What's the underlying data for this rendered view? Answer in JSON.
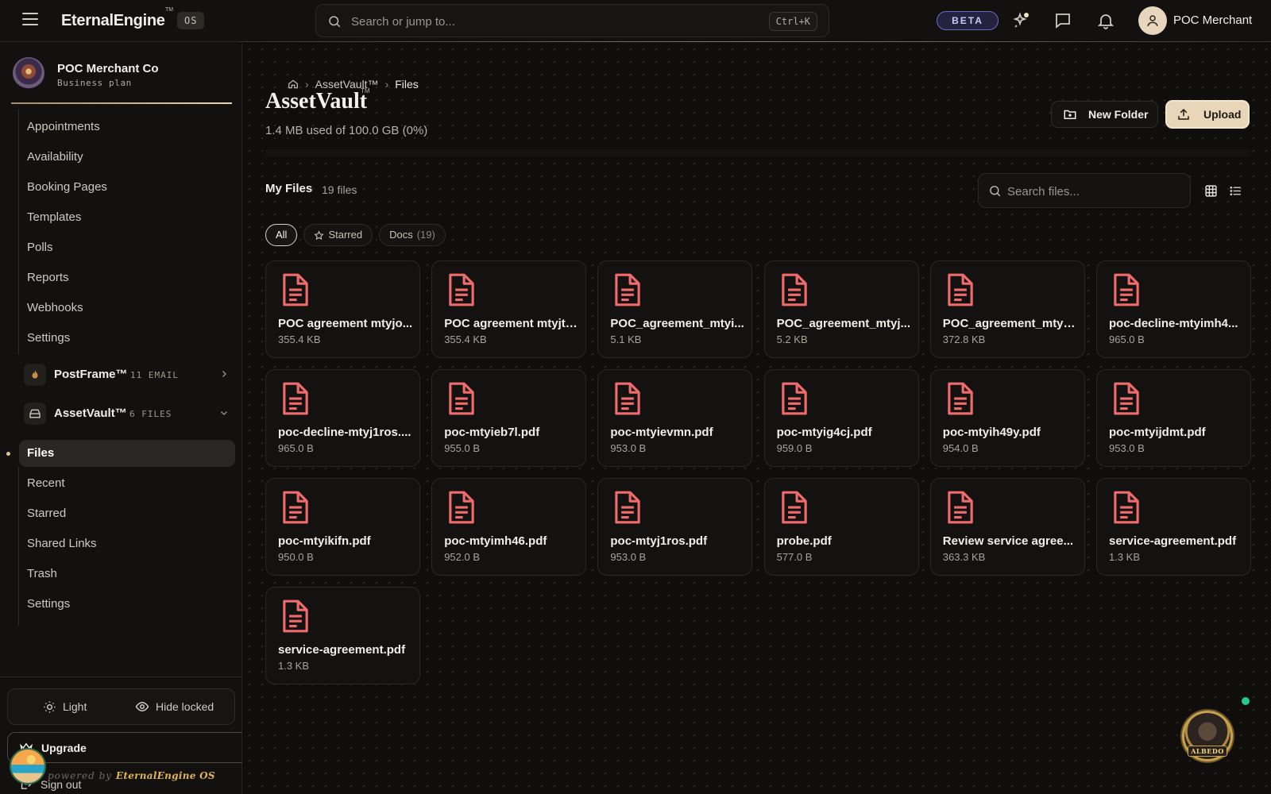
{
  "topbar": {
    "brand": "EternalEngine",
    "brand_tm": "TM",
    "os_badge": "OS",
    "search_placeholder": "Search or jump to...",
    "search_shortcut": "Ctrl+K",
    "beta_label": "BETA",
    "user_name": "POC Merchant"
  },
  "sidebar": {
    "org_name": "POC Merchant Co",
    "org_plan": "Business plan",
    "scheduling_items": [
      {
        "label": "Appointments"
      },
      {
        "label": "Availability"
      },
      {
        "label": "Booking Pages"
      },
      {
        "label": "Templates"
      },
      {
        "label": "Polls"
      },
      {
        "label": "Reports"
      },
      {
        "label": "Webhooks"
      },
      {
        "label": "Settings"
      }
    ],
    "postframe": {
      "name": "PostFrame™",
      "meta": "11 EMAIL"
    },
    "assetvault": {
      "name": "AssetVault™",
      "meta": "6 FILES"
    },
    "assetvault_items": [
      {
        "label": "Files",
        "active": true
      },
      {
        "label": "Recent"
      },
      {
        "label": "Starred"
      },
      {
        "label": "Shared Links"
      },
      {
        "label": "Trash"
      },
      {
        "label": "Settings"
      }
    ],
    "light_label": "Light",
    "hide_locked_label": "Hide locked",
    "upgrade_label": "Upgrade",
    "signout_label": "Sign out",
    "powered_prefix": "powered by",
    "powered_brand": "EternalEngine OS"
  },
  "main": {
    "breadcrumb": [
      "AssetVault™",
      "Files"
    ],
    "title": "AssetVault",
    "title_tm": "TM",
    "usage": "1.4 MB used of 100.0 GB (0%)",
    "new_folder_label": "New Folder",
    "upload_label": "Upload",
    "section_title": "My Files",
    "file_count": "19 files",
    "search_placeholder": "Search files...",
    "filters": [
      {
        "label": "All",
        "active": true
      },
      {
        "label": "Starred",
        "icon": "star-icon"
      },
      {
        "label": "Docs",
        "count": "(19)"
      }
    ],
    "files": [
      {
        "name": "POC agreement mtyjo...",
        "size": "355.4 KB"
      },
      {
        "name": "POC agreement mtyjt5...",
        "size": "355.4 KB"
      },
      {
        "name": "POC_agreement_mtyi...",
        "size": "5.1 KB"
      },
      {
        "name": "POC_agreement_mtyj...",
        "size": "5.2 KB"
      },
      {
        "name": "POC_agreement_mtyjt...",
        "size": "372.8 KB"
      },
      {
        "name": "poc-decline-mtyimh4...",
        "size": "965.0 B"
      },
      {
        "name": "poc-decline-mtyj1ros....",
        "size": "965.0 B"
      },
      {
        "name": "poc-mtyieb7l.pdf",
        "size": "955.0 B"
      },
      {
        "name": "poc-mtyievmn.pdf",
        "size": "953.0 B"
      },
      {
        "name": "poc-mtyig4cj.pdf",
        "size": "959.0 B"
      },
      {
        "name": "poc-mtyih49y.pdf",
        "size": "954.0 B"
      },
      {
        "name": "poc-mtyijdmt.pdf",
        "size": "953.0 B"
      },
      {
        "name": "poc-mtyikifn.pdf",
        "size": "950.0 B"
      },
      {
        "name": "poc-mtyimh46.pdf",
        "size": "952.0 B"
      },
      {
        "name": "poc-mtyj1ros.pdf",
        "size": "953.0 B"
      },
      {
        "name": "probe.pdf",
        "size": "577.0 B"
      },
      {
        "name": "Review service agree...",
        "size": "363.3 KB"
      },
      {
        "name": "service-agreement.pdf",
        "size": "1.3 KB"
      },
      {
        "name": "service-agreement.pdf",
        "size": "1.3 KB"
      }
    ]
  },
  "assistant": {
    "label": "ALBEDO"
  },
  "colors": {
    "accent": "#e9d6b8",
    "pdf_icon": "#f06b6b",
    "online": "#22c98a"
  }
}
